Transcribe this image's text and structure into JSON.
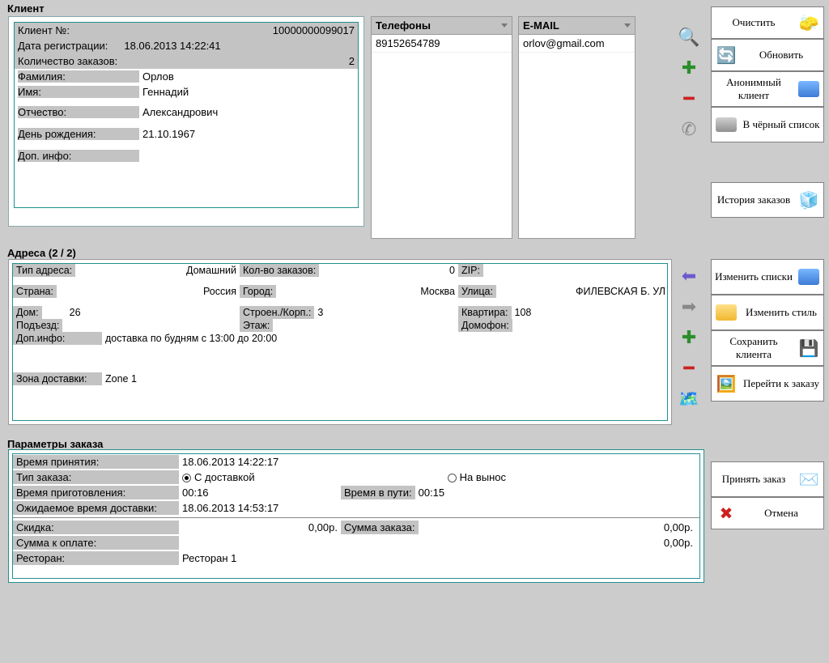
{
  "titles": {
    "client": "Клиент",
    "addresses": "Адреса  (2 / 2)",
    "order_params": "Параметры заказа"
  },
  "client": {
    "fields": {
      "number_lbl": "Клиент №:",
      "number": "10000000099017",
      "reg_lbl": "Дата регистрации:",
      "reg": "18.06.2013 14:22:41",
      "orders_lbl": "Количество заказов:",
      "orders": "2",
      "lastname_lbl": "Фамилия:",
      "lastname": "Орлов",
      "firstname_lbl": "Имя:",
      "firstname": "Геннадий",
      "patronymic_lbl": "Отчество:",
      "patronymic": "Александрович",
      "birthday_lbl": "День рождения:",
      "birthday": "21.10.1967",
      "extra_lbl": "Доп. инфо:"
    }
  },
  "phones": {
    "header": "Телефоны",
    "items": [
      "89152654789"
    ]
  },
  "email": {
    "header": "E-MAIL",
    "items": [
      "orlov@gmail.com"
    ]
  },
  "buttons_top": {
    "clear": "Очистить",
    "refresh": "Обновить",
    "anon": "Анонимный клиент",
    "blacklist": "В чёрный список"
  },
  "buttons_history": "История заказов",
  "buttons_addr": {
    "edit_lists": "Изменить списки",
    "edit_style": "Изменить стиль",
    "save_client": "Сохранить клиента",
    "goto_order": "Перейти к заказу"
  },
  "buttons_order": {
    "accept": "Принять заказ",
    "cancel": "Отмена"
  },
  "address": {
    "type_lbl": "Тип адреса:",
    "type": "Домашний",
    "orders_lbl": "Кол-во заказов:",
    "orders": "0",
    "zip_lbl": "ZIP:",
    "zip": "",
    "country_lbl": "Страна:",
    "country": "Россия",
    "city_lbl": "Город:",
    "city": "Москва",
    "street_lbl": "Улица:",
    "street": "ФИЛЕВСКАЯ Б. УЛ",
    "house_lbl": "Дом:",
    "house": "26",
    "bld_lbl": "Строен./Корп.:",
    "bld": "3",
    "apt_lbl": "Квартира:",
    "apt": "108",
    "entr_lbl": "Подъезд:",
    "floor_lbl": "Этаж:",
    "intercom_lbl": "Домофон:",
    "extra_lbl": "Доп.инфо:",
    "extra": "доставка по будням с 13:00 до 20:00",
    "zone_lbl": "Зона доставки:",
    "zone": "Zone 1"
  },
  "order": {
    "accept_time_lbl": "Время принятия:",
    "accept_time": "18.06.2013 14:22:17",
    "type_lbl": "Тип заказа:",
    "delivery_opt": "С доставкой",
    "pickup_opt": "На вынос",
    "prep_lbl": "Время приготовления:",
    "prep": "00:16",
    "travel_lbl": "Время в пути:",
    "travel": "00:15",
    "eta_lbl": "Ожидаемое время доставки:",
    "eta": "18.06.2013 14:53:17",
    "discount_lbl": "Скидка:",
    "discount": "0,00р.",
    "sum_lbl": "Сумма заказа:",
    "sum": "0,00р.",
    "pay_lbl": "Сумма к оплате:",
    "pay": "0,00р.",
    "rest_lbl": "Ресторан:",
    "rest": "Ресторан 1"
  }
}
